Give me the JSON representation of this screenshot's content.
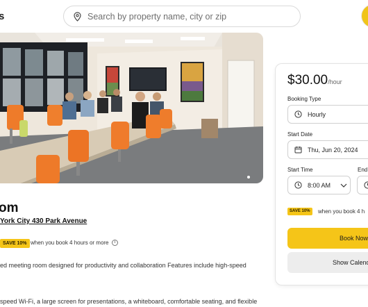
{
  "header": {
    "logo_fragment": "s",
    "search": {
      "placeholder": "Search by property name, city or zip"
    }
  },
  "listing": {
    "title_fragment": "om",
    "address_link": "York City 430 Park Avenue",
    "save_badge": "SAVE 10%",
    "save_note": "when you book 4 hours or more",
    "description_line1": "ed meeting room designed for productivity and collaboration Features include high-speed",
    "description_line2": "speed Wi-Fi, a large screen for presentations, a whiteboard, comfortable seating, and flexible"
  },
  "booking": {
    "price": "$30.00",
    "price_unit": "/hour",
    "booking_type_label": "Booking Type",
    "booking_type_value": "Hourly",
    "start_date_label": "Start Date",
    "start_date_value": "Thu, Jun 20, 2024",
    "start_time_label": "Start Time",
    "start_time_value": "8:00 AM",
    "end_time_label": "End",
    "save_badge": "SAVE 10%",
    "save_note": "when you book 4 h",
    "book_button": "Book Now",
    "calendar_button": "Show Calend"
  },
  "colors": {
    "accent": "#f5c518",
    "secondary_button": "#ededed"
  },
  "icons": [
    "location-pin-icon",
    "clock-icon",
    "calendar-icon",
    "chevron-down-icon",
    "info-icon"
  ]
}
